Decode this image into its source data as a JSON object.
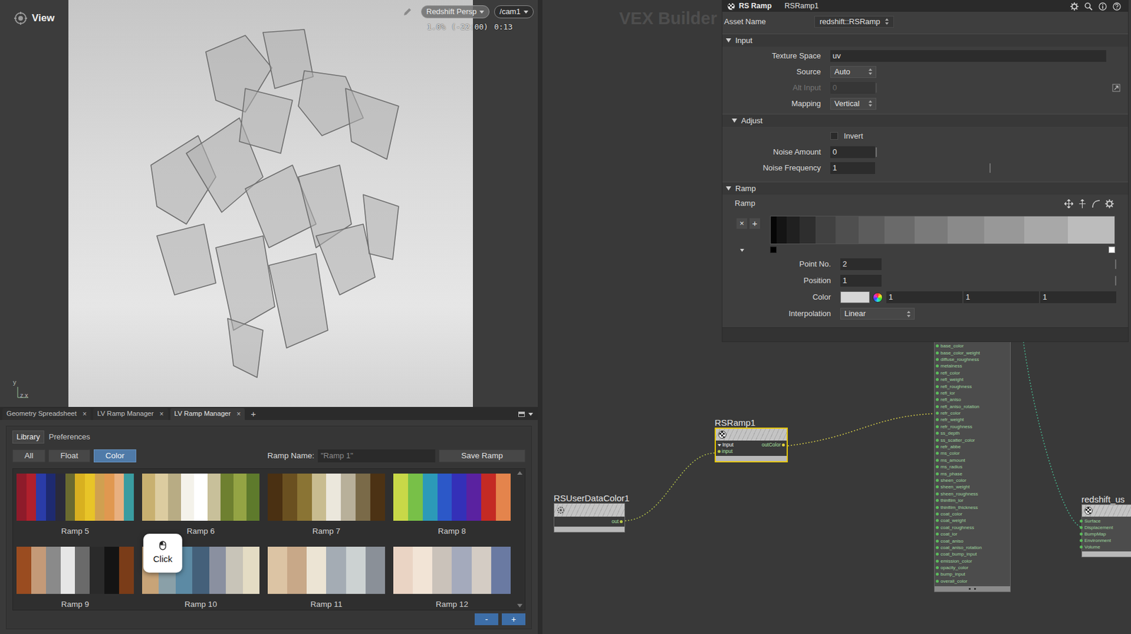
{
  "viewport": {
    "title": "View",
    "renderer_menu": "Redshift Persp",
    "camera_menu": "/cam1",
    "stats": {
      "resolution": "1.0%",
      "frame": "(-22:00)",
      "time": "0:13"
    },
    "axis_labels": [
      "y",
      "z",
      "x"
    ]
  },
  "pane_tabs": {
    "tabs": [
      {
        "label": "Geometry Spreadsheet",
        "close": "×",
        "selected": false
      },
      {
        "label": "LV Ramp Manager",
        "close": "×",
        "selected": false
      },
      {
        "label": "LV Ramp Manager",
        "close": "×",
        "selected": true
      }
    ],
    "add": "+"
  },
  "ramp_manager": {
    "tabs": [
      {
        "label": "Library",
        "selected": true
      },
      {
        "label": "Preferences",
        "selected": false
      }
    ],
    "filters": [
      {
        "label": "All",
        "selected": false
      },
      {
        "label": "Float",
        "selected": false
      },
      {
        "label": "Color",
        "selected": true
      }
    ],
    "name_label": "Ramp Name:",
    "name_value": "\"Ramp 1\"",
    "save": "Save Ramp",
    "ramps": [
      {
        "name": "Ramp 5",
        "colors": [
          "#8e1b2a",
          "#b0202c",
          "#2a3ca8",
          "#1e2a70",
          "#2a2a3a",
          "#6a6a30",
          "#d8b020",
          "#e8c428",
          "#d0a050",
          "#e09850",
          "#e8b080",
          "#3a9ca0"
        ]
      },
      {
        "name": "Ramp 6",
        "colors": [
          "#c8b070",
          "#dccca0",
          "#b8ac84",
          "#f4f2ea",
          "#ffffff",
          "#c8c09a",
          "#6e8030",
          "#94a444",
          "#5e7a2c"
        ]
      },
      {
        "name": "Ramp 7",
        "colors": [
          "#4a3012",
          "#6a5020",
          "#8a7434",
          "#c8bc90",
          "#ebe7dc",
          "#b8b09a",
          "#7a6a48",
          "#4c3214"
        ]
      },
      {
        "name": "Ramp 8",
        "colors": [
          "#c8d848",
          "#78c048",
          "#2c9ab8",
          "#2c58c8",
          "#3430b8",
          "#5a22a0",
          "#c42a24",
          "#e4844c"
        ]
      },
      {
        "name": "Ramp 9",
        "colors": [
          "#9a4c20",
          "#c49a78",
          "#8a8a8a",
          "#e6e6e6",
          "#6a6a6a",
          "#2a2a2a",
          "#141414",
          "#7a3c18"
        ]
      },
      {
        "name": "Ramp 10",
        "colors": [
          "#c8a478",
          "#8aa0a8",
          "#5c8aa4",
          "#44607a",
          "#8a90a0",
          "#c8c4b8",
          "#e4dcc4"
        ]
      },
      {
        "name": "Ramp 11",
        "colors": [
          "#dcc4a4",
          "#c8a888",
          "#ece4d4",
          "#a4acb4",
          "#ccd2d2",
          "#8a9098"
        ]
      },
      {
        "name": "Ramp 12",
        "colors": [
          "#ead4c4",
          "#f2e4d6",
          "#cac2ba",
          "#a4aabc",
          "#d4ccc4",
          "#6a7aa2"
        ]
      }
    ],
    "tooltip": {
      "text": "Click"
    },
    "remove": "-",
    "add": "+"
  },
  "network": {
    "title": "VEX Builder",
    "ramp_node": {
      "name": "RSRamp1",
      "selected": true,
      "group": "Input",
      "inputs": [
        "input"
      ],
      "outputs": [
        "outColor"
      ]
    },
    "user_data_node": {
      "name": "RSUserDataColor1",
      "outputs": [
        "out"
      ]
    },
    "material_node": {
      "inputs": [
        "base_color",
        "base_color_weight",
        "diffuse_roughness",
        "metalness",
        "refl_color",
        "refl_weight",
        "refl_roughness",
        "refl_ior",
        "refl_aniso",
        "refl_aniso_rotation",
        "refr_color",
        "refr_weight",
        "refr_roughness",
        "ss_depth",
        "ss_scatter_color",
        "refr_abbe",
        "ms_color",
        "ms_amount",
        "ms_radius",
        "ms_phase",
        "sheen_color",
        "sheen_weight",
        "sheen_roughness",
        "thinfilm_ior",
        "thinfilm_thickness",
        "coat_color",
        "coat_weight",
        "coat_roughness",
        "coat_ior",
        "coat_aniso",
        "coat_aniso_rotation",
        "coat_bump_input",
        "emission_color",
        "opacity_color",
        "bump_input",
        "overall_color"
      ]
    },
    "output_node": {
      "name": "redshift_us",
      "inputs": [
        "Surface",
        "Displacement",
        "BumpMap",
        "Environment",
        "Volume"
      ]
    }
  },
  "parameters": {
    "type": "RS Ramp",
    "node_name": "RSRamp1",
    "asset_label": "Asset Name",
    "asset": "redshift::RSRamp",
    "sections": [
      {
        "title": "Input",
        "expanded": true,
        "rows": [
          {
            "label": "Texture Space",
            "kind": "text",
            "value": "uv",
            "disabled": false,
            "chooser": false
          },
          {
            "label": "Source",
            "kind": "menu",
            "value": "Auto",
            "disabled": false,
            "chooser": false
          },
          {
            "label": "Alt Input",
            "kind": "slider",
            "value": "0",
            "level": 0,
            "disabled": true,
            "chooser": true
          },
          {
            "label": "Mapping",
            "kind": "menu",
            "value": "Vertical",
            "disabled": false,
            "chooser": false
          }
        ]
      },
      {
        "title": "Adjust",
        "expanded": true,
        "rows": [
          {
            "label": "Invert",
            "kind": "checkbox",
            "checked": false,
            "disabled": false,
            "chooser": false
          },
          {
            "label": "Noise Amount",
            "kind": "slider",
            "value": "0",
            "level": 0,
            "disabled": false,
            "chooser": false
          },
          {
            "label": "Noise Frequency",
            "kind": "slider",
            "value": "1",
            "level": 0.48,
            "disabled": false,
            "chooser": false
          }
        ]
      }
    ],
    "ramp_section": {
      "title": "Ramp",
      "expanded": true,
      "label": "Ramp",
      "remove": "×",
      "add": "+",
      "steps": [
        "#050505",
        "#141414",
        "#202020",
        "#2e2e2e",
        "#414141",
        "#4f4f4f",
        "#5c5c5c",
        "#6a6a6a",
        "#7a7a7a",
        "#8a8a8a",
        "#989898",
        "#a8a8a8",
        "#bcbcbc"
      ],
      "points": [
        {
          "color": "#000000",
          "level": 0,
          "selected": false
        },
        {
          "color": "#ffffff",
          "level": 1,
          "selected": true
        }
      ],
      "point_no": {
        "label": "Point No.",
        "value": "2",
        "level": 1
      },
      "position": {
        "label": "Position",
        "value": "1",
        "level": 1
      },
      "color": {
        "label": "Color",
        "swatch": "#d6d6d6",
        "values": [
          "1",
          "1",
          "1"
        ]
      },
      "interpolation": {
        "label": "Interpolation",
        "value": "Linear"
      }
    }
  }
}
